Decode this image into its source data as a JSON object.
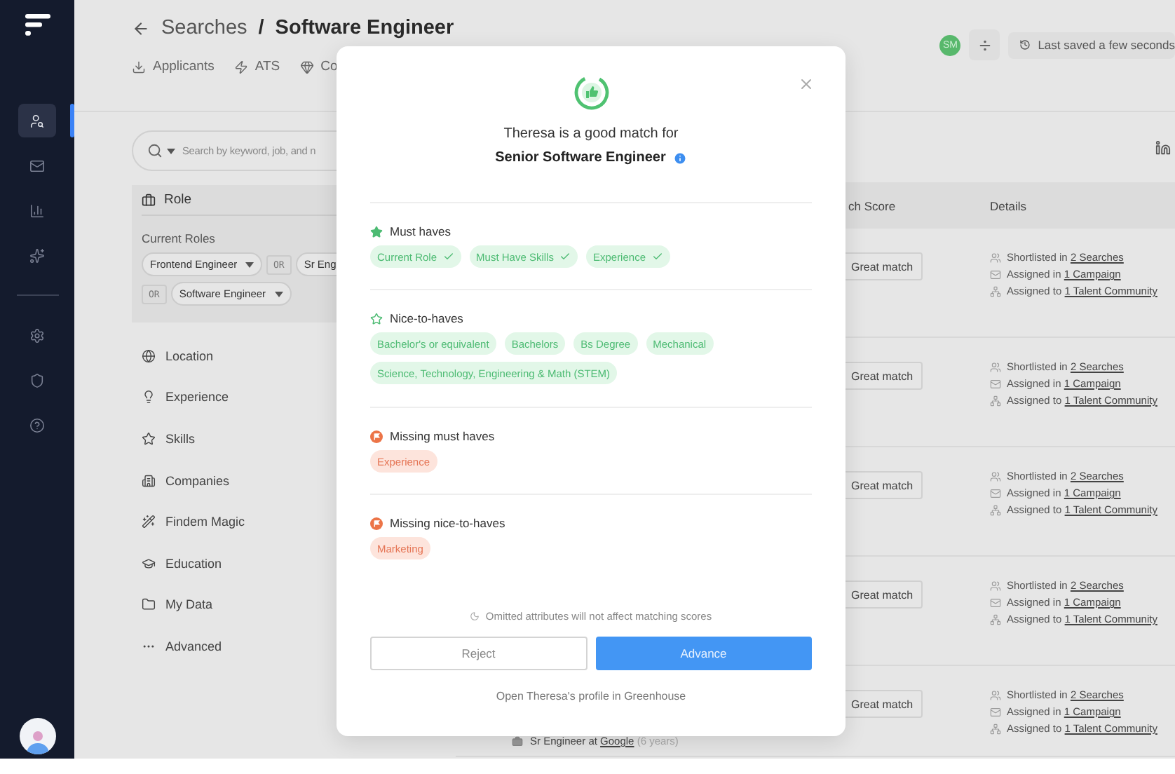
{
  "sidebar": {
    "nav": [
      {
        "selected": true
      },
      {
        "selected": false
      },
      {
        "selected": false
      },
      {
        "selected": false
      }
    ]
  },
  "header": {
    "parent": "Searches",
    "separator": "/",
    "current": "Software Engineer",
    "tabs": [
      "Applicants",
      "ATS",
      "Co"
    ],
    "avatar_initials": "SM",
    "last_saved": "Last saved a few seconds"
  },
  "filters": {
    "search": {
      "placeholder": "Search by keyword, job, and n"
    },
    "role": {
      "title": "Role",
      "group_label": "Current Roles",
      "chips": [
        {
          "kind": "value",
          "label": "Frontend Engineer"
        },
        {
          "kind": "operator",
          "label": "OR"
        },
        {
          "kind": "value",
          "label": "Sr Eng"
        },
        {
          "kind": "operator",
          "label": "OR"
        },
        {
          "kind": "value",
          "label": "Software Engineer"
        }
      ]
    },
    "items": [
      "Location",
      "Experience",
      "Skills",
      "Companies",
      "Findem Magic",
      "Education",
      "My Data",
      "Advanced"
    ]
  },
  "table": {
    "columns": [
      "ch Score",
      "Details"
    ],
    "rows": [
      {
        "score": "Great match",
        "details": [
          {
            "text": "Shortlisted in",
            "link": "2 Searches"
          },
          {
            "text": "Assigned in",
            "link": "1 Campaign"
          },
          {
            "text": "Assigned to",
            "link": "1 Talent Community"
          }
        ]
      },
      {
        "score": "Great match",
        "details": [
          {
            "text": "Shortlisted in",
            "link": "2 Searches"
          },
          {
            "text": "Assigned in",
            "link": "1 Campaign"
          },
          {
            "text": "Assigned to",
            "link": "1 Talent Community"
          }
        ]
      },
      {
        "score": "Great match",
        "details": [
          {
            "text": "Shortlisted in",
            "link": "2 Searches"
          },
          {
            "text": "Assigned in",
            "link": "1 Campaign"
          },
          {
            "text": "Assigned to",
            "link": "1 Talent Community"
          }
        ]
      },
      {
        "score": "Great match",
        "details": [
          {
            "text": "Shortlisted in",
            "link": "2 Searches"
          },
          {
            "text": "Assigned in",
            "link": "1 Campaign"
          },
          {
            "text": "Assigned to",
            "link": "1 Talent Community"
          }
        ]
      },
      {
        "score": "Great match",
        "details": [
          {
            "text": "Shortlisted in",
            "link": "2 Searches"
          },
          {
            "text": "Assigned in",
            "link": "1 Campaign"
          },
          {
            "text": "Assigned to",
            "link": "1 Talent Community"
          }
        ],
        "experience": {
          "title": "Sr Engineer at",
          "company": "Google",
          "duration": "(6 years)"
        }
      }
    ]
  },
  "modal": {
    "title": "Theresa is a good match for",
    "role": "Senior Software Engineer",
    "sections": [
      {
        "kind": "must",
        "heading": "Must haves",
        "chips": [
          {
            "label": "Current Role",
            "checked": true
          },
          {
            "label": "Must Have Skills",
            "checked": true
          },
          {
            "label": "Experience",
            "checked": true
          }
        ]
      },
      {
        "kind": "nice",
        "heading": "Nice-to-haves",
        "chips": [
          {
            "label": "Bachelor's or equivalent",
            "checked": false
          },
          {
            "label": "Bachelors",
            "checked": false
          },
          {
            "label": "Bs Degree",
            "checked": false
          },
          {
            "label": "Mechanical",
            "checked": false
          },
          {
            "label": "Science, Technology, Engineering & Math (STEM)",
            "checked": false
          }
        ]
      },
      {
        "kind": "missing",
        "heading": "Missing must haves",
        "chips": [
          {
            "label": "Experience",
            "checked": false
          }
        ]
      },
      {
        "kind": "missing",
        "heading": "Missing nice-to-haves",
        "chips": [
          {
            "label": "Marketing",
            "checked": false
          }
        ]
      }
    ],
    "note": "Omitted attributes will not affect matching scores",
    "buttons": [
      {
        "kind": "secondary",
        "label": "Reject"
      },
      {
        "kind": "primary",
        "label": "Advance"
      }
    ],
    "link": "Open Theresa's profile in Greenhouse"
  }
}
